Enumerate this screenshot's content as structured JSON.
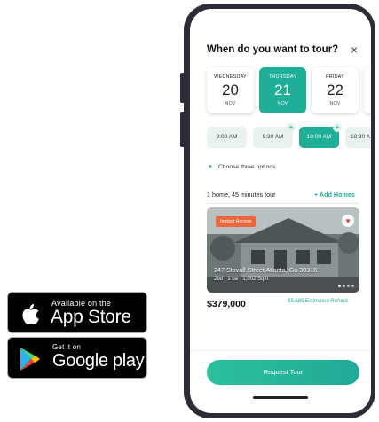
{
  "badges": {
    "apple": {
      "small": "Available on the",
      "big": "App Store"
    },
    "google": {
      "small": "Get it on",
      "big": "Google play"
    }
  },
  "tour": {
    "title": "When do you want to tour?",
    "close": "×",
    "days": [
      {
        "dow": "WEDNESDAY",
        "num": "20",
        "mon": "NOV"
      },
      {
        "dow": "THURSDAY",
        "num": "21",
        "mon": "NOV"
      },
      {
        "dow": "FRIDAY",
        "num": "22",
        "mon": "NOV"
      }
    ],
    "selected_day": 1,
    "times": [
      "9:00 AM",
      "9:30 AM",
      "10:00 AM",
      "10:30 A"
    ],
    "selected_time": 2,
    "choose": "Choose three options",
    "summary": "1 home, 45 minutes tour",
    "add_homes": "+ Add Homes"
  },
  "listing": {
    "badge": "Instant Access",
    "address": "247 Stovall Street Atlanta, Ga 30316",
    "details": "2bd · 1 ba · 1,002 Sq ft",
    "price": "$379,000",
    "refund": "$5,685 Estimated Refund"
  },
  "cta": {
    "request": "Request Tour"
  },
  "colors": {
    "accent": "#1fae97",
    "badge": "#e8683f",
    "heart": "#e94b4b"
  }
}
